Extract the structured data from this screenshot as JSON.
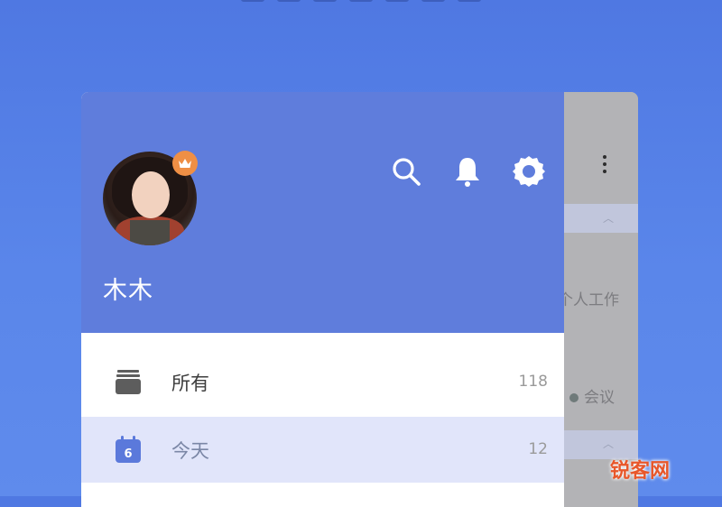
{
  "drawer": {
    "user": {
      "name": "木木",
      "badge_icon": "crown-icon"
    },
    "header_icons": [
      "search-icon",
      "bell-icon",
      "gear-icon"
    ],
    "items": [
      {
        "label": "所有",
        "count": "118",
        "icon": "inbox-stack-icon"
      },
      {
        "label": "今天",
        "count": "12",
        "icon": "calendar-today-icon",
        "calendar_day": "6"
      }
    ]
  },
  "background_app": {
    "texts": [
      "个人工作",
      "会议"
    ]
  },
  "watermark": "锐客网",
  "colors": {
    "header": "#5f7ddc",
    "selected_row": "#e1e5fa",
    "badge": "#ef8f45",
    "page_bg": "#5580e6"
  }
}
